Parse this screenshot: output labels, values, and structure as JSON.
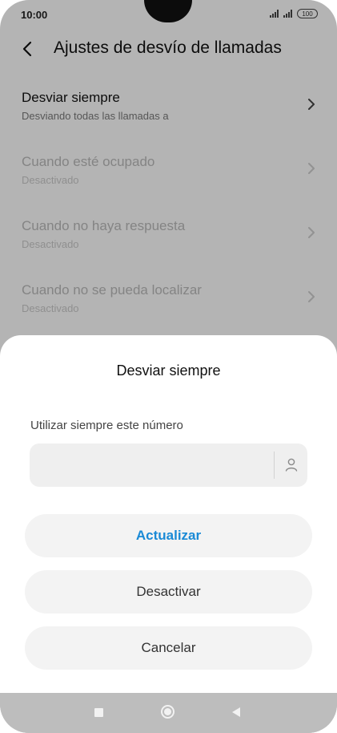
{
  "status_bar": {
    "time": "10:00",
    "battery": "100"
  },
  "header": {
    "title": "Ajustes de desvío de llamadas"
  },
  "list": {
    "items": [
      {
        "title": "Desviar siempre",
        "subtitle": "Desviando todas las llamadas a"
      },
      {
        "title": "Cuando esté ocupado",
        "subtitle": "Desactivado"
      },
      {
        "title": "Cuando no haya respuesta",
        "subtitle": "Desactivado"
      },
      {
        "title": "Cuando no se pueda localizar",
        "subtitle": "Desactivado"
      }
    ]
  },
  "dialog": {
    "title": "Desviar siempre",
    "field_label": "Utilizar siempre este número",
    "field_value": "",
    "update_label": "Actualizar",
    "disable_label": "Desactivar",
    "cancel_label": "Cancelar"
  },
  "colors": {
    "accent": "#1a8ad6",
    "overlay": "rgba(0,0,0,0.27)",
    "nav_bar": "#bdbdbd"
  },
  "icons": {
    "back": "back-arrow-icon",
    "chevron": "chevron-right-icon",
    "contact": "contact-person-icon",
    "nav_recent": "square-recent-apps-icon",
    "nav_home": "circle-home-icon",
    "nav_back": "triangle-back-icon"
  }
}
